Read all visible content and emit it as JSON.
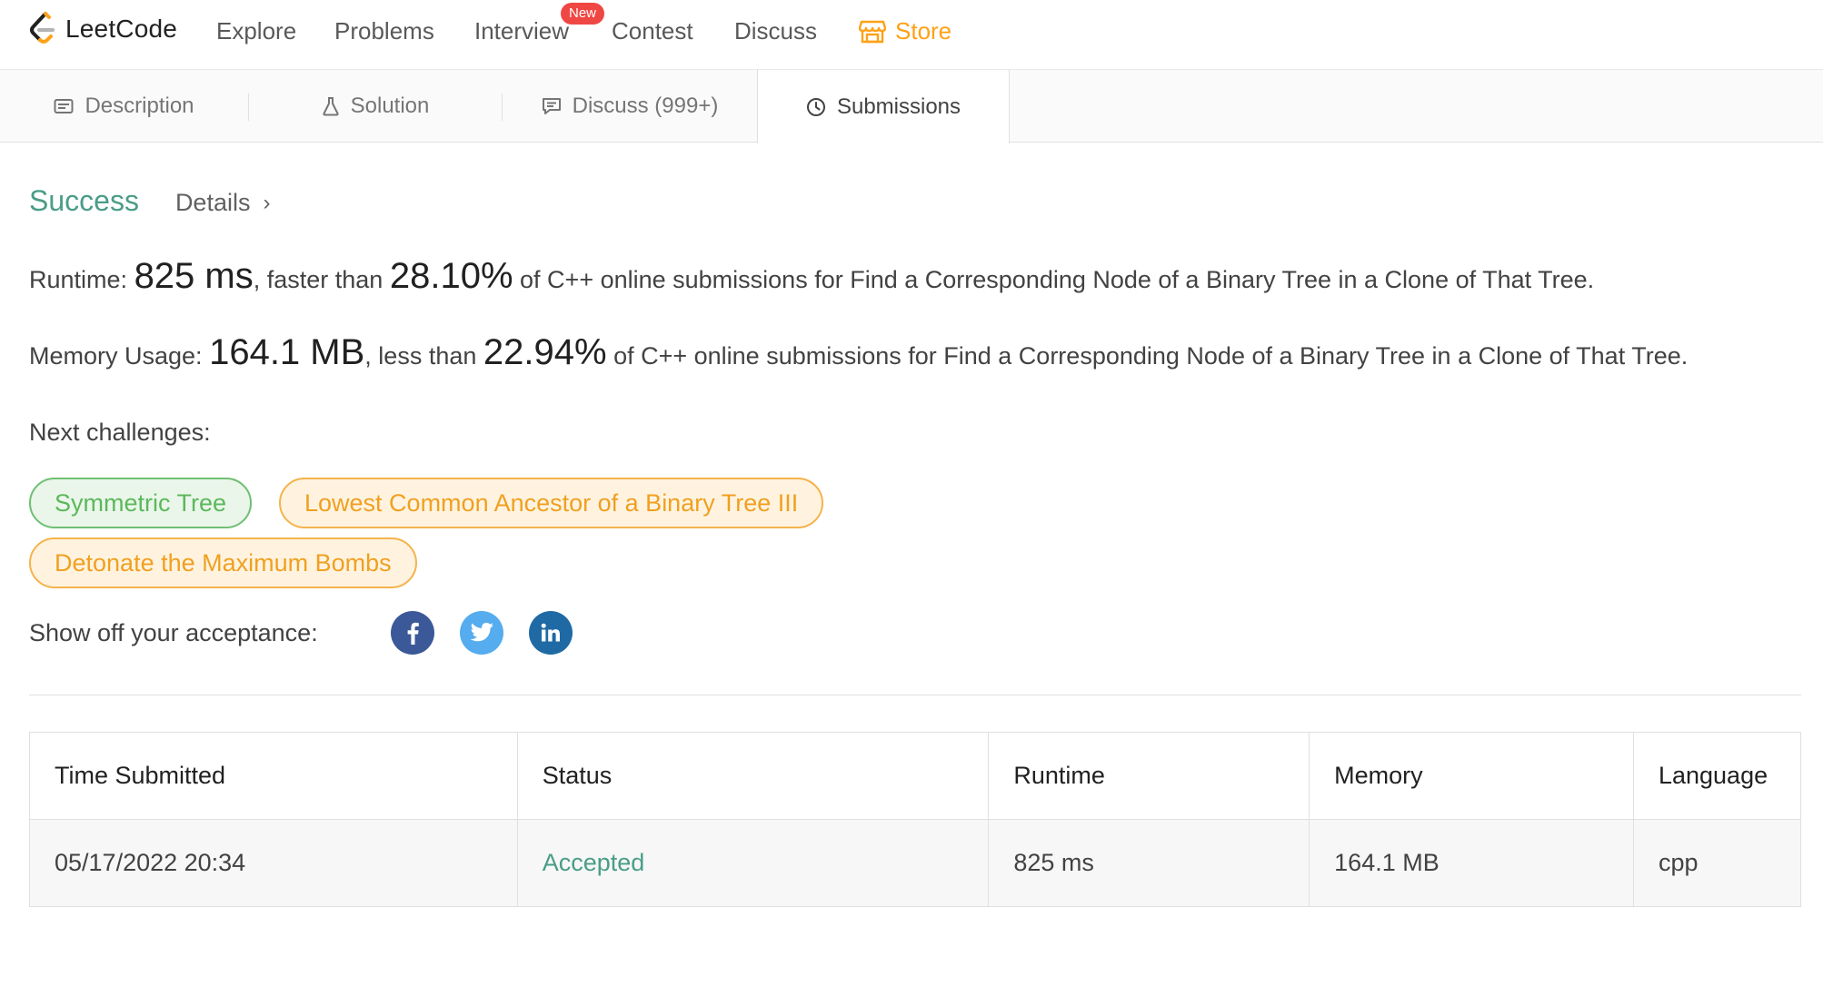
{
  "nav": {
    "logo_text": "LeetCode",
    "items": [
      {
        "label": "Explore"
      },
      {
        "label": "Problems"
      },
      {
        "label": "Interview"
      },
      {
        "label": "Contest"
      },
      {
        "label": "Discuss"
      },
      {
        "label": "Store"
      }
    ],
    "new_badge": "New",
    "accent_color": "#ffa116"
  },
  "tabs": [
    {
      "label": "Description",
      "icon": "description-icon"
    },
    {
      "label": "Solution",
      "icon": "flask-icon"
    },
    {
      "label": "Discuss (999+)",
      "icon": "comment-icon"
    },
    {
      "label": "Submissions",
      "icon": "clock-icon",
      "active": true
    }
  ],
  "result": {
    "status": "Success",
    "details_label": "Details",
    "runtime": {
      "label": "Runtime:",
      "value": "825 ms",
      "comparator": ", faster than",
      "percent": "28.10%",
      "suffix": "of C++ online submissions for Find a Corresponding Node of a Binary Tree in a Clone of That Tree."
    },
    "memory": {
      "label": "Memory Usage:",
      "value": "164.1 MB",
      "comparator": ", less than",
      "percent": "22.94%",
      "suffix": "of C++ online submissions for Find a Corresponding Node of a Binary Tree in a Clone of That Tree."
    },
    "success_color": "#4a9d87"
  },
  "next_challenges": {
    "label": "Next challenges:",
    "items": [
      {
        "label": "Symmetric Tree",
        "difficulty": "easy"
      },
      {
        "label": "Lowest Common Ancestor of a Binary Tree III",
        "difficulty": "medium"
      },
      {
        "label": "Detonate the Maximum Bombs",
        "difficulty": "medium"
      }
    ]
  },
  "share": {
    "label": "Show off your acceptance:",
    "networks": [
      {
        "icon": "facebook-icon",
        "color": "#3b5998"
      },
      {
        "icon": "twitter-icon",
        "color": "#55acee"
      },
      {
        "icon": "linkedin-icon",
        "color": "#1f6aa5"
      }
    ]
  },
  "submissions_table": {
    "columns": [
      "Time Submitted",
      "Status",
      "Runtime",
      "Memory",
      "Language"
    ],
    "rows": [
      [
        "05/17/2022 20:34",
        "Accepted",
        "825 ms",
        "164.1 MB",
        "cpp"
      ]
    ]
  }
}
